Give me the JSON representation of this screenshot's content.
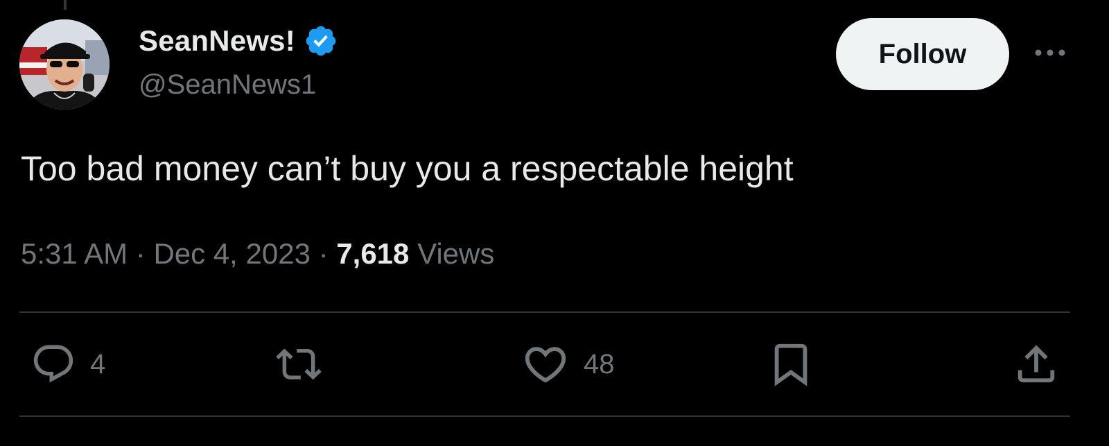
{
  "author": {
    "display_name": "SeanNews!",
    "handle": "@SeanNews1",
    "verified": true
  },
  "follow_label": "Follow",
  "tweet": {
    "text": "Too bad money can’t buy you a respectable height",
    "time": "5:31 AM",
    "separator": "·",
    "date": "Dec 4, 2023",
    "views_count": "7,618",
    "views_label": "Views"
  },
  "actions": {
    "reply_count": "4",
    "like_count": "48"
  },
  "icons": {
    "verified": "verified-badge-icon",
    "more": "more-horizontal-icon",
    "reply": "reply-bubble-icon",
    "retweet": "retweet-icon",
    "like": "heart-icon",
    "bookmark": "bookmark-icon",
    "share": "share-icon"
  },
  "colors": {
    "background": "#000000",
    "primary_text": "#e7e9ea",
    "secondary_text": "#71767b",
    "verified_blue": "#1d9bf0",
    "follow_bg": "#eff3f4",
    "divider": "#2f3336"
  }
}
